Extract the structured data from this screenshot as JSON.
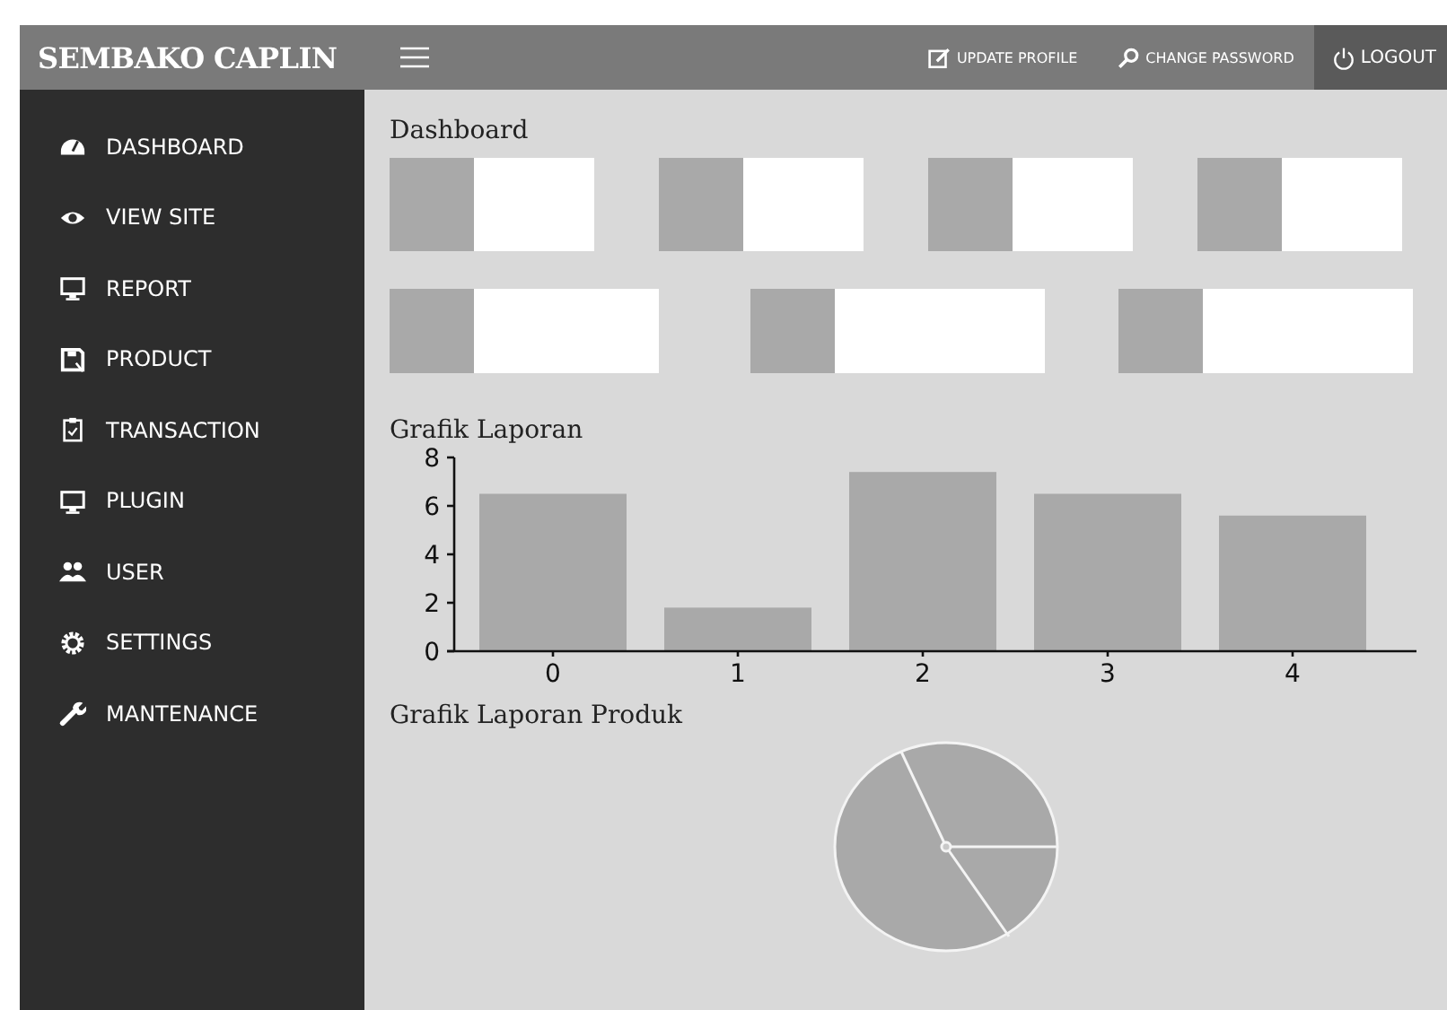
{
  "header": {
    "brand": "SEMBAKO CAPLIN",
    "actions": [
      {
        "kind": "edit",
        "label": "UPDATE PROFILE"
      },
      {
        "kind": "key",
        "label": "CHANGE PASSWORD"
      },
      {
        "kind": "power",
        "label": "LOGOUT"
      }
    ]
  },
  "sidebar": {
    "items": [
      {
        "kind": "gauge",
        "label": "DASHBOARD"
      },
      {
        "kind": "eye",
        "label": "VIEW SITE"
      },
      {
        "kind": "monitor",
        "label": "REPORT"
      },
      {
        "kind": "save",
        "label": "PRODUCT"
      },
      {
        "kind": "clipboard",
        "label": "TRANSACTION"
      },
      {
        "kind": "monitor",
        "label": "PLUGIN"
      },
      {
        "kind": "users",
        "label": "USER"
      },
      {
        "kind": "gear",
        "label": "SETTINGS"
      },
      {
        "kind": "wrench",
        "label": "MANTENANCE"
      }
    ]
  },
  "main": {
    "title": "Dashboard",
    "card_rows": [
      [
        {
          "kind": "stat"
        },
        {
          "kind": "stat"
        },
        {
          "kind": "stat"
        },
        {
          "kind": "stat"
        }
      ],
      [
        {
          "kind": "wide"
        },
        {
          "kind": "wide"
        },
        {
          "kind": "wide"
        }
      ]
    ],
    "report_chart": {
      "title": "Grafik Laporan",
      "chart_data": {
        "type": "bar",
        "categories": [
          "0",
          "1",
          "2",
          "3",
          "4"
        ],
        "values": [
          6.5,
          1.8,
          7.4,
          6.5,
          5.6
        ],
        "ylim": [
          0,
          8
        ],
        "yticks": [
          0,
          2,
          4,
          6,
          8
        ]
      }
    },
    "product_chart": {
      "title": "Grafik Laporan Produk",
      "kind": "picture"
    }
  }
}
